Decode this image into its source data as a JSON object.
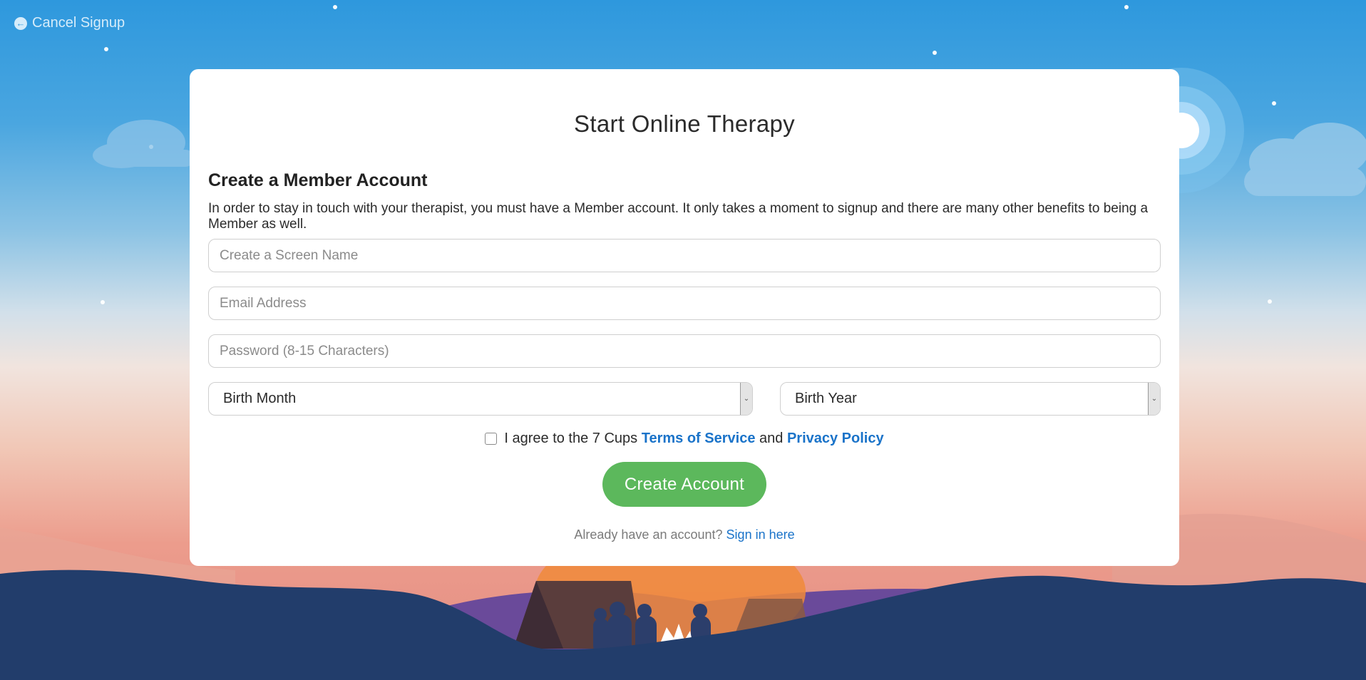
{
  "nav": {
    "cancel_label": "Cancel Signup",
    "cancel_icon": "arrow-circle-left-icon"
  },
  "card": {
    "title": "Start Online Therapy",
    "subtitle": "Create a Member Account",
    "description": "In order to stay in touch with your therapist, you must have a Member account. It only takes a moment to signup and there are many other benefits to being a Member as well."
  },
  "form": {
    "screen_name_placeholder": "Create a Screen Name",
    "email_placeholder": "Email Address",
    "password_placeholder": "Password (8-15 Characters)",
    "birth_month_selected": "Birth Month",
    "birth_year_selected": "Birth Year",
    "agree_prefix": "I agree to the 7 Cups",
    "terms_link": "Terms of Service",
    "agree_and": "and",
    "privacy_link": "Privacy Policy",
    "agree_checked": false,
    "submit_label": "Create Account",
    "signin_prompt": "Already have an account?",
    "signin_link": "Sign in here"
  },
  "colors": {
    "primary_button": "#5cb85c",
    "link": "#1a73c9",
    "sky_top": "#2e98dd",
    "ground": "#223d6b"
  }
}
